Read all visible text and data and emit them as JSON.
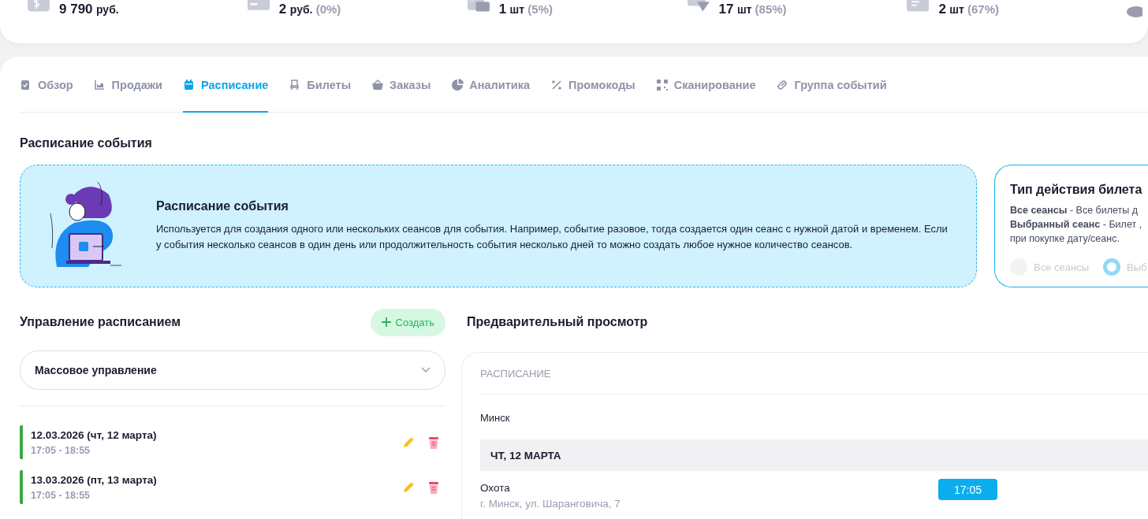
{
  "stats": [
    {
      "amount": "9 790",
      "unit": "руб."
    },
    {
      "amount": "2",
      "unit": "руб.",
      "percent": "(0%)"
    },
    {
      "amount": "1",
      "unit": "шт",
      "percent": "(5%)"
    },
    {
      "amount": "17",
      "unit": "шт",
      "percent": "(85%)"
    },
    {
      "amount": "2",
      "unit": "шт",
      "percent": "(67%)"
    }
  ],
  "tabs": [
    {
      "label": "Обзор",
      "selected": false
    },
    {
      "label": "Продажи",
      "selected": false
    },
    {
      "label": "Расписание",
      "selected": true
    },
    {
      "label": "Билеты",
      "selected": false
    },
    {
      "label": "Заказы",
      "selected": false
    },
    {
      "label": "Аналитика",
      "selected": false
    },
    {
      "label": "Промокоды",
      "selected": false
    },
    {
      "label": "Сканирование",
      "selected": false
    },
    {
      "label": "Группа событий",
      "selected": false
    }
  ],
  "section_title": "Расписание события",
  "info": {
    "title": "Расписание события",
    "text": "Используется для создания одного или нескольких сеансов для события. Например, событие разовое, тогда создается один сеанс с нужной датой и временем. Если у события несколько сеансов в один день или продолжительность события несколько дней то можно создать любое нужное количество сеансов."
  },
  "ticket_type": {
    "title": "Тип действия билета",
    "lines": [
      "**Все сеансы** - Все билеты д",
      "**Выбранный сеанс** - Билет ,",
      "при покупке дату/сеанс."
    ],
    "disabled": true,
    "options": [
      {
        "label": "Все сеансы",
        "selected": false
      },
      {
        "label": "Выб",
        "selected": true
      }
    ]
  },
  "management": {
    "title": "Управление расписанием",
    "create_button": "Создать",
    "bulk_select": "Массовое управление",
    "sessions": [
      {
        "date": "12.03.2026 (чт, 12 марта)",
        "time": "17:05 - 18:55"
      },
      {
        "date": "13.03.2026 (пт, 13 марта)",
        "time": "17:05 - 18:55"
      }
    ]
  },
  "preview": {
    "title": "Предварительный просмотр",
    "heading": "РАСПИСАНИЕ",
    "city": "Минск",
    "day": "ЧТ, 12 МАРТА",
    "venue": "Охота",
    "address": "г. Минск, ул. Шаранговича, 7",
    "times": [
      "17:05"
    ]
  }
}
